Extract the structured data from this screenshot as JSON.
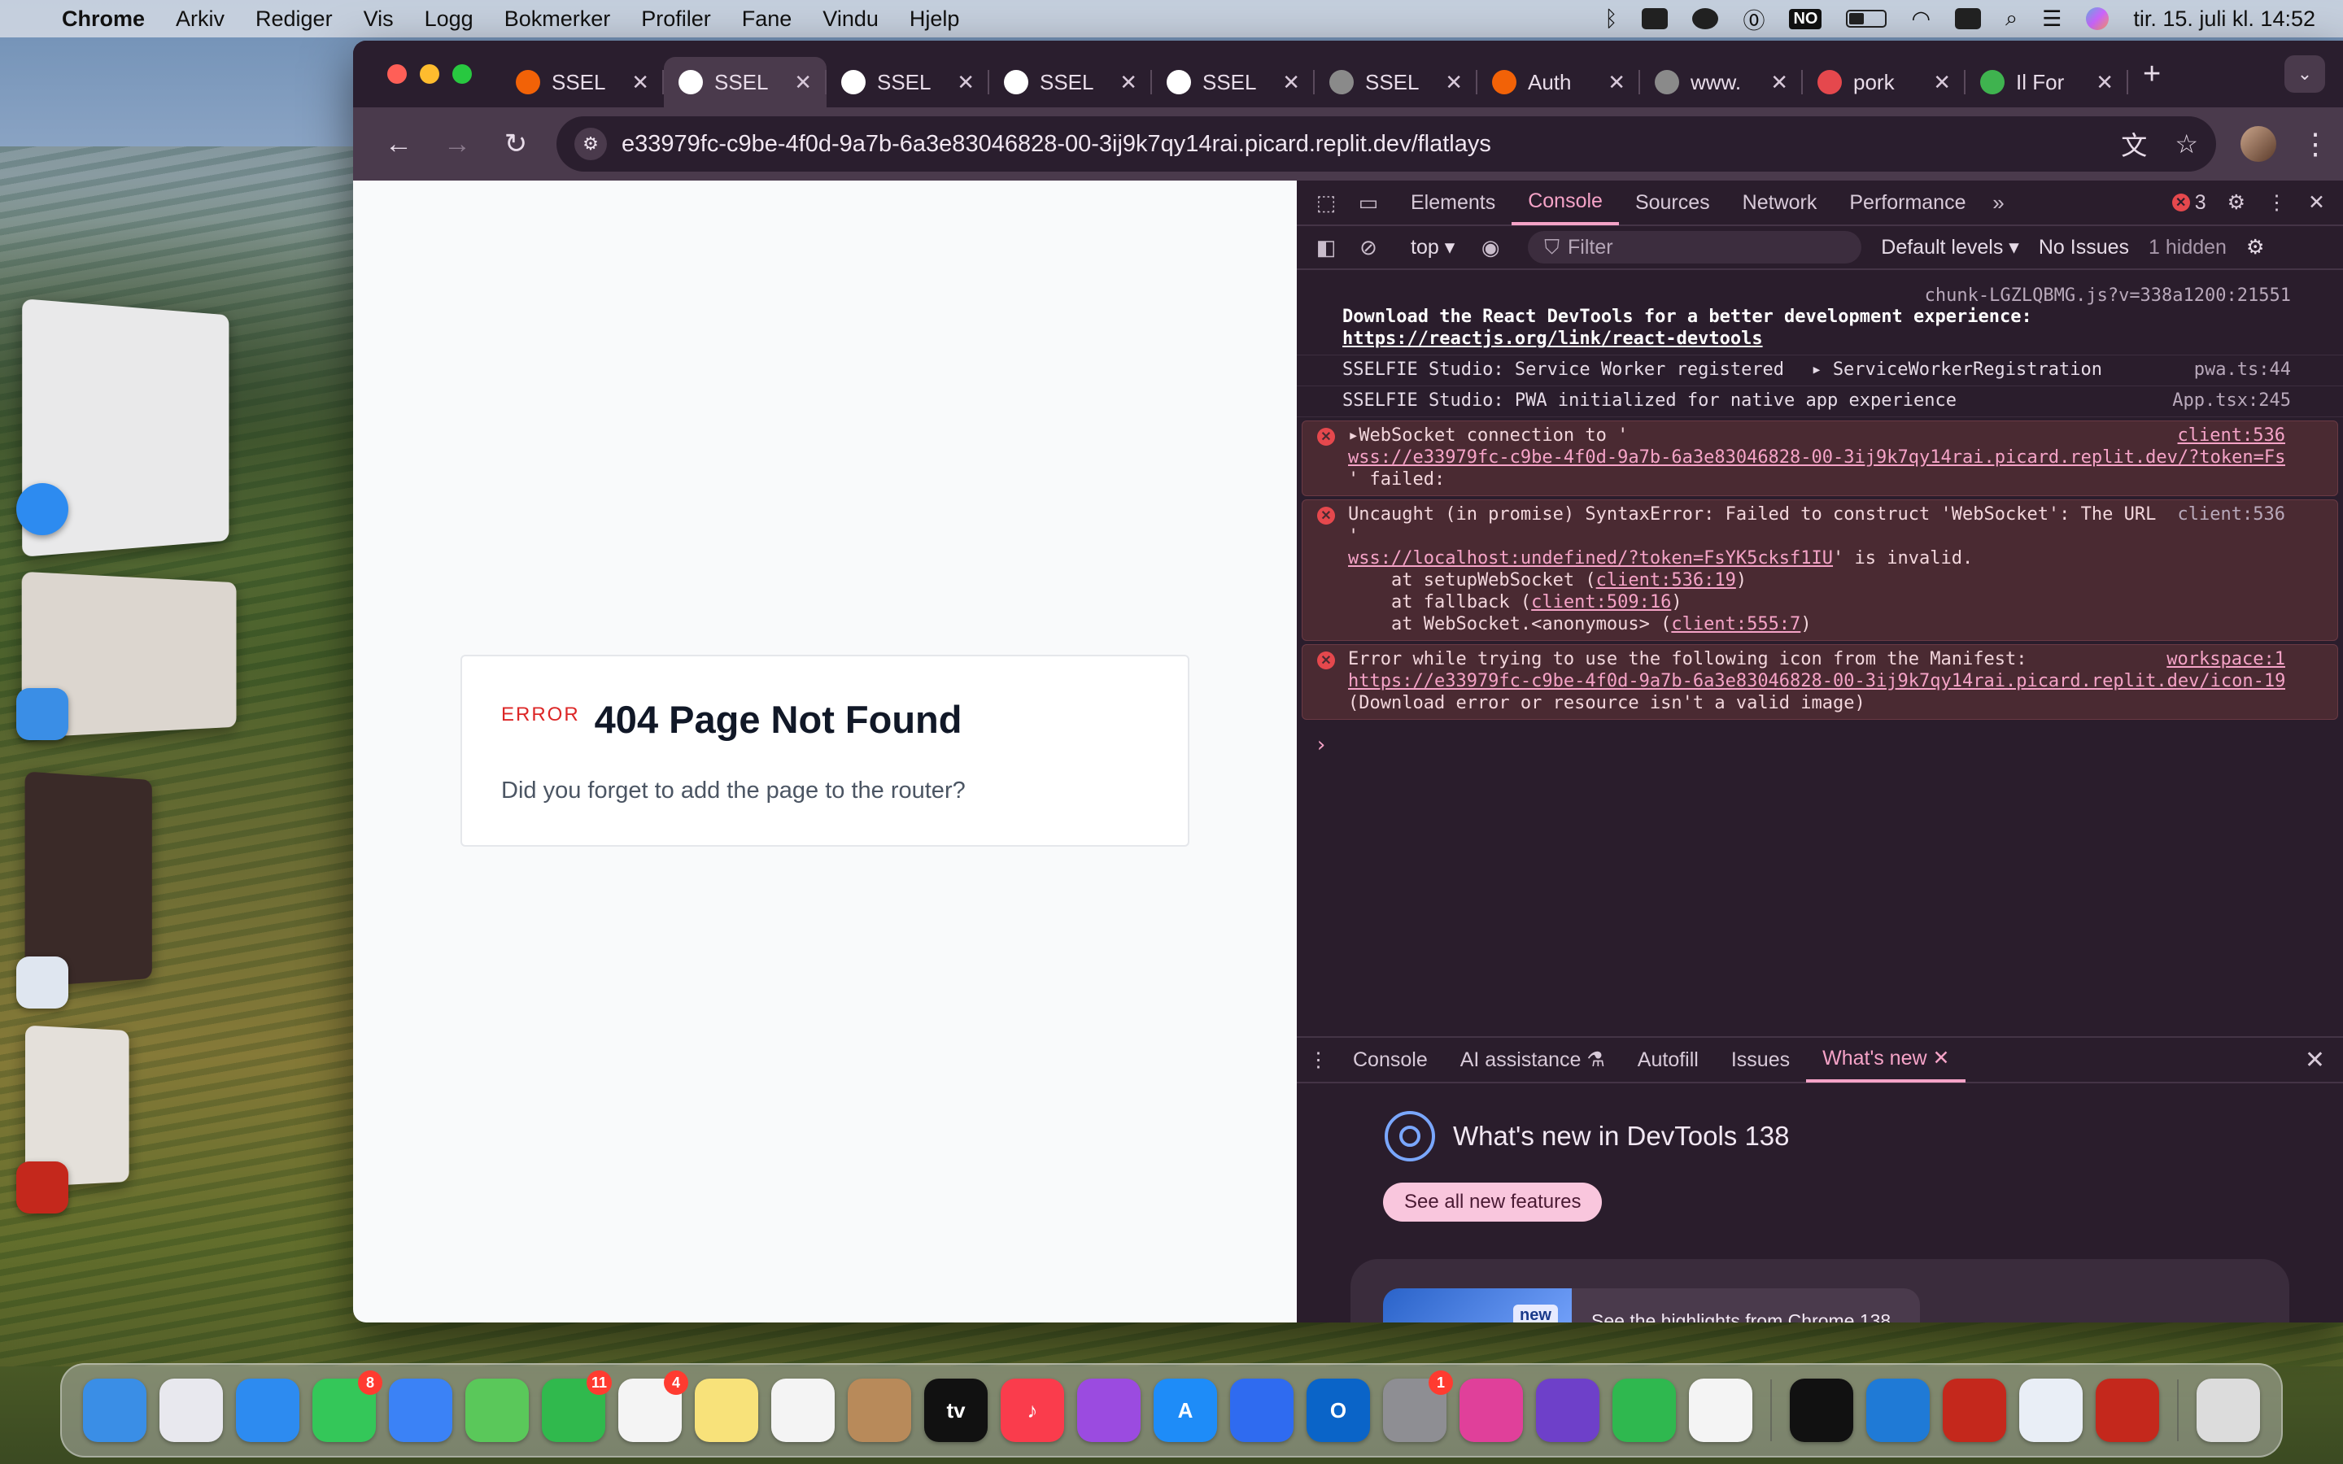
{
  "menubar": {
    "app": "Chrome",
    "items": [
      "Arkiv",
      "Rediger",
      "Vis",
      "Logg",
      "Bokmerker",
      "Profiler",
      "Fane",
      "Vindu",
      "Hjelp"
    ],
    "input_badge": "NO",
    "clock": "tir. 15. juli kl. 14:52"
  },
  "tabs": [
    {
      "label": "SSEL",
      "icon": "replit-icon",
      "color": "#f26207",
      "active": false
    },
    {
      "label": "SSEL",
      "icon": "google-icon",
      "color": "#ffffff",
      "active": true
    },
    {
      "label": "SSEL",
      "icon": "google-icon",
      "color": "#ffffff",
      "active": false
    },
    {
      "label": "SSEL",
      "icon": "google-icon",
      "color": "#ffffff",
      "active": false
    },
    {
      "label": "SSEL",
      "icon": "google-icon",
      "color": "#ffffff",
      "active": false
    },
    {
      "label": "SSEL",
      "icon": "globe-icon",
      "color": "#8a8a8a",
      "active": false
    },
    {
      "label": "Auth",
      "icon": "replit-icon",
      "color": "#f26207",
      "active": false
    },
    {
      "label": "www.",
      "icon": "globe-icon",
      "color": "#8a8a8a",
      "active": false
    },
    {
      "label": "pork",
      "icon": "app-icon",
      "color": "#e5484d",
      "active": false
    },
    {
      "label": "Il For",
      "icon": "ubereats-icon",
      "color": "#3fb34f",
      "active": false
    }
  ],
  "omnibox": {
    "url": "e33979fc-c9be-4f0d-9a7b-6a3e83046828-00-3ij9k7qy14rai.picard.replit.dev/flatlays"
  },
  "page": {
    "error_label": "ERROR",
    "title": "404 Page Not Found",
    "message": "Did you forget to add the page to the router?"
  },
  "devtools": {
    "tabs": [
      "Elements",
      "Console",
      "Sources",
      "Network",
      "Performance"
    ],
    "active_tab": "Console",
    "error_count": "3",
    "context": "top",
    "filter_placeholder": "Filter",
    "levels": "Default levels",
    "issues": "No Issues",
    "hidden": "1 hidden",
    "messages": {
      "m1_src": "chunk-LGZLQBMG.js?v=338a1200:21551",
      "m1_line1": "Download the React DevTools for a better development experience:",
      "m1_link": "https://reactjs.org/link/react-devtools",
      "m2_text": "SSELFIE Studio: Service Worker registered",
      "m2_obj": "ServiceWorkerRegistration",
      "m2_src": "pwa.ts:44",
      "m3_text": "SSELFIE Studio: PWA initialized for native app experience",
      "m3_src": "App.tsx:245",
      "e1_text": "WebSocket connection to '",
      "e1_link": "wss://e33979fc-c9be-4f0d-9a7b-6a3e83046828-00-3ij9k7qy14rai.picard.replit.dev/?token=Fs…",
      "e1_tail": "' failed:",
      "e1_src": "client:536",
      "e2_text": "Uncaught (in promise) SyntaxError: Failed to construct 'WebSocket': The URL '",
      "e2_link": "wss://localhost:undefined/?token=FsYK5cksf1IU",
      "e2_tail": "' is invalid.",
      "e2_src": "client:536",
      "e2_stack1_pre": "    at setupWebSocket (",
      "e2_stack1_link": "client:536:19",
      "e2_stack2_pre": "    at fallback (",
      "e2_stack2_link": "client:509:16",
      "e2_stack3_pre": "    at WebSocket.<anonymous> (",
      "e2_stack3_link": "client:555:7",
      "e3_text": "Error while trying to use the following icon from the Manifest:",
      "e3_link": "https://e33979fc-c9be-4f0d-9a7b-6a3e83046828-00-3ij9k7qy14rai.picard.replit.dev/icon-19…",
      "e3_tail": "(Download error or resource isn't a valid image)",
      "e3_src": "workspace:1"
    },
    "drawer_tabs": [
      "Console",
      "AI assistance",
      "Autofill",
      "Issues",
      "What's new"
    ],
    "whats_new_title": "What's new in DevTools 138",
    "see_all": "See all new features",
    "new_badge": "new",
    "highlight": "See the highlights from Chrome 138"
  },
  "dock": [
    {
      "name": "finder",
      "color": "#3a8ee6",
      "glyph": "",
      "badge": ""
    },
    {
      "name": "launchpad",
      "color": "#e8e8ee",
      "glyph": "",
      "badge": ""
    },
    {
      "name": "safari",
      "color": "#2d8bf0",
      "glyph": "",
      "badge": ""
    },
    {
      "name": "messages",
      "color": "#34c759",
      "glyph": "",
      "badge": "8"
    },
    {
      "name": "mail",
      "color": "#3b82f6",
      "glyph": "",
      "badge": ""
    },
    {
      "name": "maps",
      "color": "#5ac85a",
      "glyph": "",
      "badge": ""
    },
    {
      "name": "facetime",
      "color": "#30b94d",
      "glyph": "",
      "badge": "11"
    },
    {
      "name": "reminders",
      "color": "#f4f4f4",
      "glyph": "",
      "badge": "4"
    },
    {
      "name": "notes",
      "color": "#f8e27a",
      "glyph": "",
      "badge": ""
    },
    {
      "name": "freeform",
      "color": "#f4f4f4",
      "glyph": "",
      "badge": ""
    },
    {
      "name": "contacts",
      "color": "#b88a5a",
      "glyph": "",
      "badge": ""
    },
    {
      "name": "tv",
      "color": "#111111",
      "glyph": "tv",
      "badge": ""
    },
    {
      "name": "music",
      "color": "#fa3c4c",
      "glyph": "♪",
      "badge": ""
    },
    {
      "name": "podcasts",
      "color": "#9b4be0",
      "glyph": "",
      "badge": ""
    },
    {
      "name": "app-store",
      "color": "#1e8cf8",
      "glyph": "A",
      "badge": ""
    },
    {
      "name": "screens",
      "color": "#2f6bf0",
      "glyph": "",
      "badge": ""
    },
    {
      "name": "outlook",
      "color": "#0a64c8",
      "glyph": "O",
      "badge": ""
    },
    {
      "name": "system-settings",
      "color": "#8e8e93",
      "glyph": "",
      "badge": "1"
    },
    {
      "name": "keynote",
      "color": "#e0409a",
      "glyph": "",
      "badge": ""
    },
    {
      "name": "github-desktop",
      "color": "#6e40c9",
      "glyph": "",
      "badge": ""
    },
    {
      "name": "numbers",
      "color": "#2fb84f",
      "glyph": "",
      "badge": ""
    },
    {
      "name": "chrome",
      "color": "#f4f4f4",
      "glyph": "",
      "badge": ""
    },
    {
      "name": "sep",
      "color": "",
      "glyph": "",
      "badge": ""
    },
    {
      "name": "unity",
      "color": "#111111",
      "glyph": "",
      "badge": ""
    },
    {
      "name": "vscode",
      "color": "#1f7ad6",
      "glyph": "",
      "badge": ""
    },
    {
      "name": "acrobat",
      "color": "#c4281c",
      "glyph": "",
      "badge": ""
    },
    {
      "name": "preview",
      "color": "#e9eef6",
      "glyph": "",
      "badge": ""
    },
    {
      "name": "acrobat-reader",
      "color": "#c4281c",
      "glyph": "",
      "badge": ""
    },
    {
      "name": "sep",
      "color": "",
      "glyph": "",
      "badge": ""
    },
    {
      "name": "trash",
      "color": "#dcdcdc",
      "glyph": "",
      "badge": ""
    }
  ]
}
